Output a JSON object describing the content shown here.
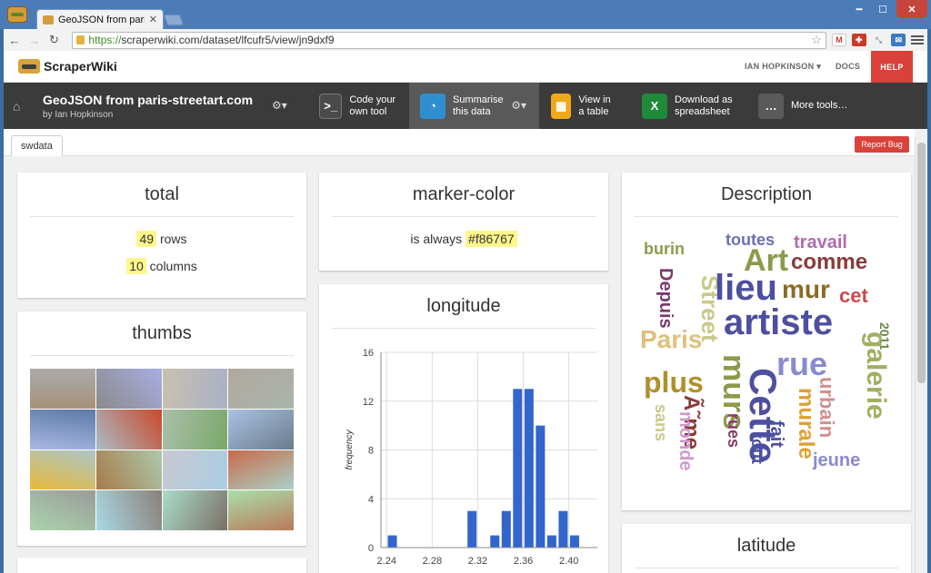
{
  "browser": {
    "tab_title": "GeoJSON from paris-stree",
    "url_scheme": "https://",
    "url_rest": "scraperwiki.com/dataset/lfcufr5/view/jn9dxf9"
  },
  "nav": {
    "logo": "ScraperWiki",
    "user": "IAN HOPKINSON",
    "docs": "DOCS",
    "help": "HELP"
  },
  "dataset": {
    "title": "GeoJSON from paris-streetart.com",
    "byline": "by Ian Hopkinson"
  },
  "tools": [
    {
      "label": "Code your own tool",
      "line1": "Code your",
      "line2": "own tool",
      "icon": "terminal-icon",
      "color": "#4a4a4a"
    },
    {
      "label": "Summarise this data",
      "line1": "Summarise",
      "line2": "this data",
      "icon": "pie-chart-icon",
      "color": "#2f8ecf"
    },
    {
      "label": "View in a table",
      "line1": "View in",
      "line2": "a table",
      "icon": "table-icon",
      "color": "#f0a91a"
    },
    {
      "label": "Download as spreadsheet",
      "line1": "Download as",
      "line2": "spreadsheet",
      "icon": "excel-icon",
      "color": "#1f8a3a"
    },
    {
      "label": "More tools…",
      "line1": "More tools…",
      "line2": "",
      "icon": "more-icon",
      "color": "#5a5a5a"
    }
  ],
  "tabs": {
    "active": "swdata",
    "report_bug": "Report Bug"
  },
  "cards": {
    "total": {
      "title": "total",
      "rows_value": "49",
      "rows_label": "rows",
      "cols_value": "10",
      "cols_label": "columns"
    },
    "marker": {
      "title": "marker-color",
      "prefix": "is always",
      "value": "#f86767"
    },
    "description": {
      "title": "Description"
    },
    "thumbs": {
      "title": "thumbs"
    },
    "longitude": {
      "title": "longitude"
    },
    "latitude": {
      "title": "latitude"
    }
  },
  "wordcloud": [
    {
      "text": "toutes",
      "color": "#6b6fb8"
    },
    {
      "text": "travail",
      "color": "#b06bb0"
    },
    {
      "text": "burin",
      "color": "#8a9b4a"
    },
    {
      "text": "Art",
      "color": "#8a9b4a"
    },
    {
      "text": "comme",
      "color": "#8b3a3a"
    },
    {
      "text": "Street",
      "color": "#c9c98a"
    },
    {
      "text": "Depuis",
      "color": "#7a3a6a"
    },
    {
      "text": "lieu",
      "color": "#4d4fa0"
    },
    {
      "text": "mur",
      "color": "#8a6a2a"
    },
    {
      "text": "cet",
      "color": "#c94a4a"
    },
    {
      "text": "artiste",
      "color": "#4d4fa0"
    },
    {
      "text": "Paris",
      "color": "#e0c07a"
    },
    {
      "text": "2011",
      "color": "#6b8a4a"
    },
    {
      "text": "rue",
      "color": "#8a8ad0"
    },
    {
      "text": "galerie",
      "color": "#a0b060"
    },
    {
      "text": "plus",
      "color": "#b0902a"
    },
    {
      "text": "murs",
      "color": "#8a9b4a"
    },
    {
      "text": "Cette",
      "color": "#4d4fa0"
    },
    {
      "text": "urbain",
      "color": "#d09090"
    },
    {
      "text": "murale",
      "color": "#e0a030"
    },
    {
      "text": "Ã˜me",
      "color": "#8b3a3a"
    },
    {
      "text": "sans",
      "color": "#c9c98a"
    },
    {
      "text": "monde",
      "color": "#d09ad0"
    },
    {
      "text": "rues",
      "color": "#8a3a6a"
    },
    {
      "text": "fait",
      "color": "#4d4fa0"
    },
    {
      "text": "tout",
      "color": "#4d4fa0"
    },
    {
      "text": "jeune",
      "color": "#8a8ad0"
    }
  ],
  "thumb_colors": [
    "#a8927a",
    "#8a8a8a",
    "#c8c0b0",
    "#b0a8a0",
    "#5a7aa8",
    "#c84a2a",
    "#7aa86a",
    "#6a7a8a",
    "#e8b83a",
    "#a87a4a",
    "#c8c8d0",
    "#c86a4a",
    "#9a9a9a",
    "#8a8078",
    "#7a7068",
    "#b87a5a"
  ],
  "chart_data": {
    "type": "bar",
    "title": "longitude",
    "xlabel": "",
    "ylabel": "frequency",
    "bins": [
      2.245,
      2.255,
      2.265,
      2.275,
      2.285,
      2.295,
      2.305,
      2.315,
      2.325,
      2.335,
      2.345,
      2.355,
      2.365,
      2.375,
      2.385,
      2.395,
      2.405,
      2.415
    ],
    "values": [
      1,
      0,
      0,
      0,
      0,
      0,
      0,
      3,
      0,
      1,
      3,
      13,
      13,
      10,
      1,
      3,
      1,
      0
    ],
    "xticks": [
      2.24,
      2.28,
      2.32,
      2.36,
      2.4
    ],
    "yticks": [
      0,
      4,
      8,
      12,
      16
    ],
    "xlim": [
      2.235,
      2.425
    ],
    "ylim": [
      0,
      16
    ],
    "bar_color": "#3366cc"
  }
}
